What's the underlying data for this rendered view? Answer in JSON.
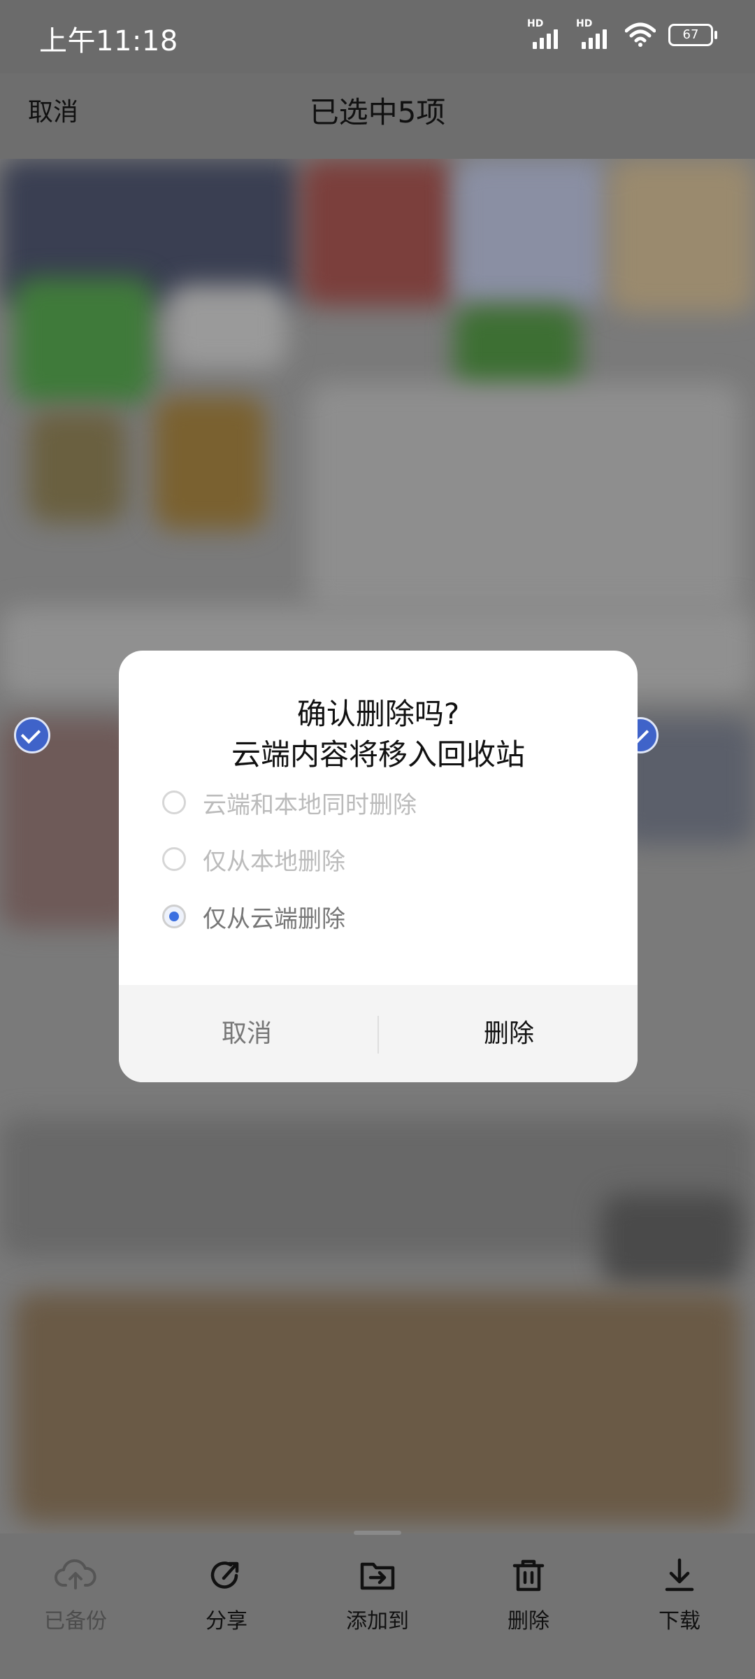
{
  "status_bar": {
    "time": "上午11:18",
    "battery": "67",
    "signal_label": "HD"
  },
  "header": {
    "cancel": "取消",
    "title": "已选中5项"
  },
  "dialog": {
    "title_line1": "确认删除吗?",
    "title_line2": "云端内容将移入回收站",
    "options": [
      {
        "label": "云端和本地同时删除",
        "selected": false
      },
      {
        "label": "仅从本地删除",
        "selected": false
      },
      {
        "label": "仅从云端删除",
        "selected": true
      }
    ],
    "cancel": "取消",
    "confirm": "删除"
  },
  "bottom_bar": {
    "items": [
      {
        "label": "已备份",
        "icon": "cloud-upload-icon",
        "enabled": false
      },
      {
        "label": "分享",
        "icon": "share-icon",
        "enabled": true
      },
      {
        "label": "添加到",
        "icon": "add-to-folder-icon",
        "enabled": true
      },
      {
        "label": "删除",
        "icon": "trash-icon",
        "enabled": true
      },
      {
        "label": "下载",
        "icon": "download-icon",
        "enabled": true
      }
    ]
  }
}
